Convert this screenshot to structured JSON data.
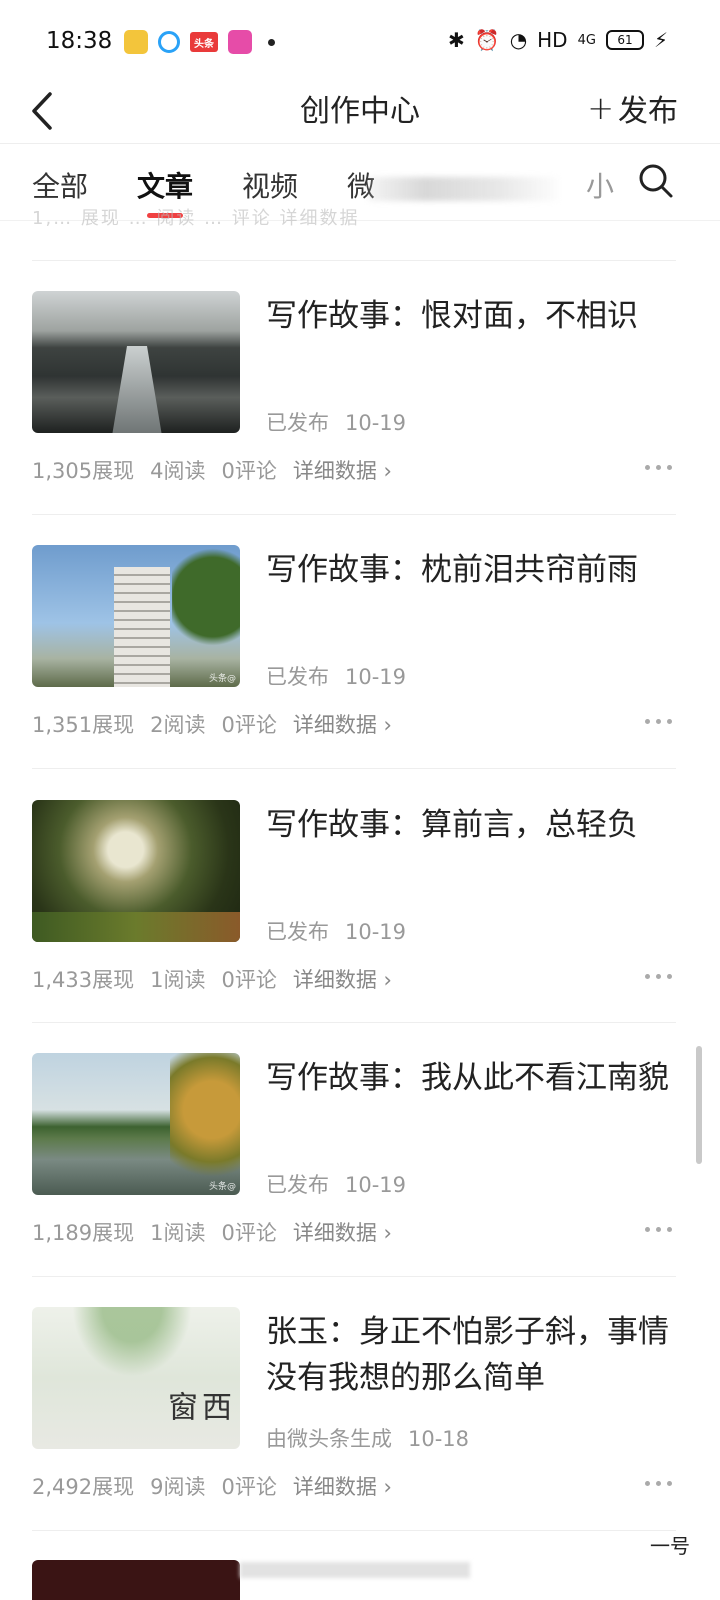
{
  "status_bar": {
    "time": "18:38",
    "app_icons": [
      "notes-icon",
      "qq-icon",
      "toutiao-icon",
      "bilibili-icon"
    ],
    "toutiao_label": "头条",
    "network": "HD",
    "signal": "4G",
    "battery": "61"
  },
  "header": {
    "title": "创作中心",
    "publish_label": "发布"
  },
  "tabs": [
    {
      "label": "全部"
    },
    {
      "label": "文章"
    },
    {
      "label": "视频"
    },
    {
      "label": "微"
    },
    {
      "label": "小"
    }
  ],
  "active_tab": "文章",
  "accent_color": "#f04142",
  "cut_off_row": "1,… 展现 … 阅读 … 评论 详细数据",
  "articles": [
    {
      "title": "写作故事：恨对面，不相识",
      "status": "已发布",
      "date": "10-19",
      "views": "1,305展现",
      "reads": "4阅读",
      "comments": "0评论",
      "detail": "详细数据",
      "thumbnail": "canal-photo"
    },
    {
      "title": "写作故事：枕前泪共帘前雨",
      "status": "已发布",
      "date": "10-19",
      "views": "1,351展现",
      "reads": "2阅读",
      "comments": "0评论",
      "detail": "详细数据",
      "thumbnail": "tower-photo"
    },
    {
      "title": "写作故事：算前言，总轻负",
      "status": "已发布",
      "date": "10-19",
      "views": "1,433展现",
      "reads": "1阅读",
      "comments": "0评论",
      "detail": "详细数据",
      "thumbnail": "trees-photo"
    },
    {
      "title": "写作故事：我从此不看江南貌",
      "status": "已发布",
      "date": "10-19",
      "views": "1,189展现",
      "reads": "1阅读",
      "comments": "0评论",
      "detail": "详细数据",
      "thumbnail": "lake-photo"
    },
    {
      "title": "张玉：身正不怕影子斜，事情没有我想的那么简单",
      "status": "由微头条生成",
      "date": "10-18",
      "views": "2,492展现",
      "reads": "9阅读",
      "comments": "0评论",
      "detail": "详细数据",
      "thumbnail": "poster-image",
      "poster_text": "西窗"
    }
  ],
  "watermark": "头条@",
  "corner_text": "一号"
}
